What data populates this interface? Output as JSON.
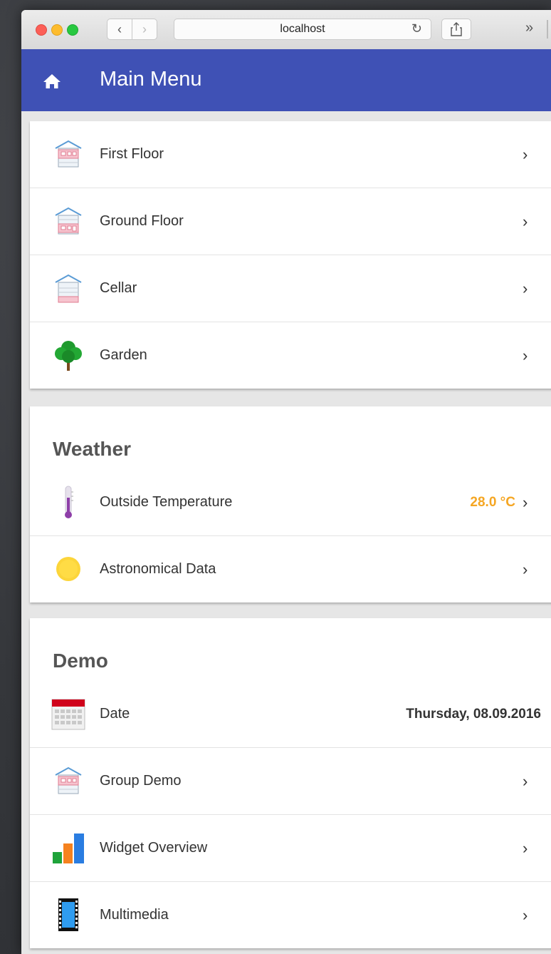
{
  "browser": {
    "url": "localhost",
    "back_glyph": "‹",
    "forward_glyph": "›",
    "reload_glyph": "↻",
    "more_glyph": "»"
  },
  "header": {
    "title": "Main Menu",
    "icon": "home-icon",
    "color": "#3f51b5"
  },
  "floors": [
    {
      "label": "First Floor",
      "icon": "house-first-floor-icon"
    },
    {
      "label": "Ground Floor",
      "icon": "house-ground-floor-icon"
    },
    {
      "label": "Cellar",
      "icon": "house-cellar-icon"
    },
    {
      "label": "Garden",
      "icon": "tree-icon"
    }
  ],
  "weather": {
    "title": "Weather",
    "items": [
      {
        "label": "Outside Temperature",
        "value": "28.0 °C",
        "icon": "thermometer-icon",
        "value_color": "#f5a623"
      },
      {
        "label": "Astronomical Data",
        "icon": "sun-icon"
      }
    ]
  },
  "demo": {
    "title": "Demo",
    "items": [
      {
        "label": "Date",
        "value": "Thursday, 08.09.2016",
        "icon": "calendar-icon"
      },
      {
        "label": "Group Demo",
        "icon": "house-group-icon"
      },
      {
        "label": "Widget Overview",
        "icon": "bar-chart-icon"
      },
      {
        "label": "Multimedia",
        "icon": "film-icon"
      }
    ]
  },
  "chevron": "›"
}
